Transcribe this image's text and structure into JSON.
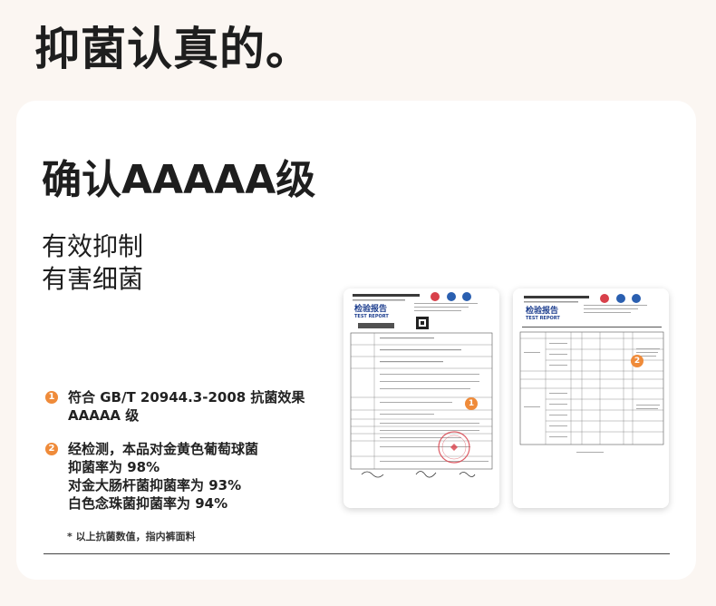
{
  "page_title": "抑菌认真的。",
  "level_title": "确认AAAAA级",
  "claim": [
    "有效抑制",
    "有害细菌"
  ],
  "points": [
    {
      "badge": "1",
      "lines": [
        "符合 GB/T 20944.3-2008 抗菌效果",
        "AAAAA 级"
      ]
    },
    {
      "badge": "2",
      "lines": [
        "经检测，本品对金黄色葡萄球菌",
        "抑菌率为 98%",
        "对金大肠杆菌抑菌率为 93%",
        "白色念珠菌抑菌率为 94%"
      ]
    }
  ],
  "footnote": "* 以上抗菌数值，指内裤面料",
  "reports": [
    {
      "heading": "检验报告",
      "subheading": "TEST REPORT",
      "badge": "1"
    },
    {
      "heading": "检验报告",
      "subheading": "TEST REPORT",
      "badge": "2"
    }
  ],
  "colors": {
    "accent": "#ef8b3a",
    "page_bg": "#fbf6f2",
    "stamp": "#d8404a",
    "report_blue": "#1e3f8f"
  }
}
